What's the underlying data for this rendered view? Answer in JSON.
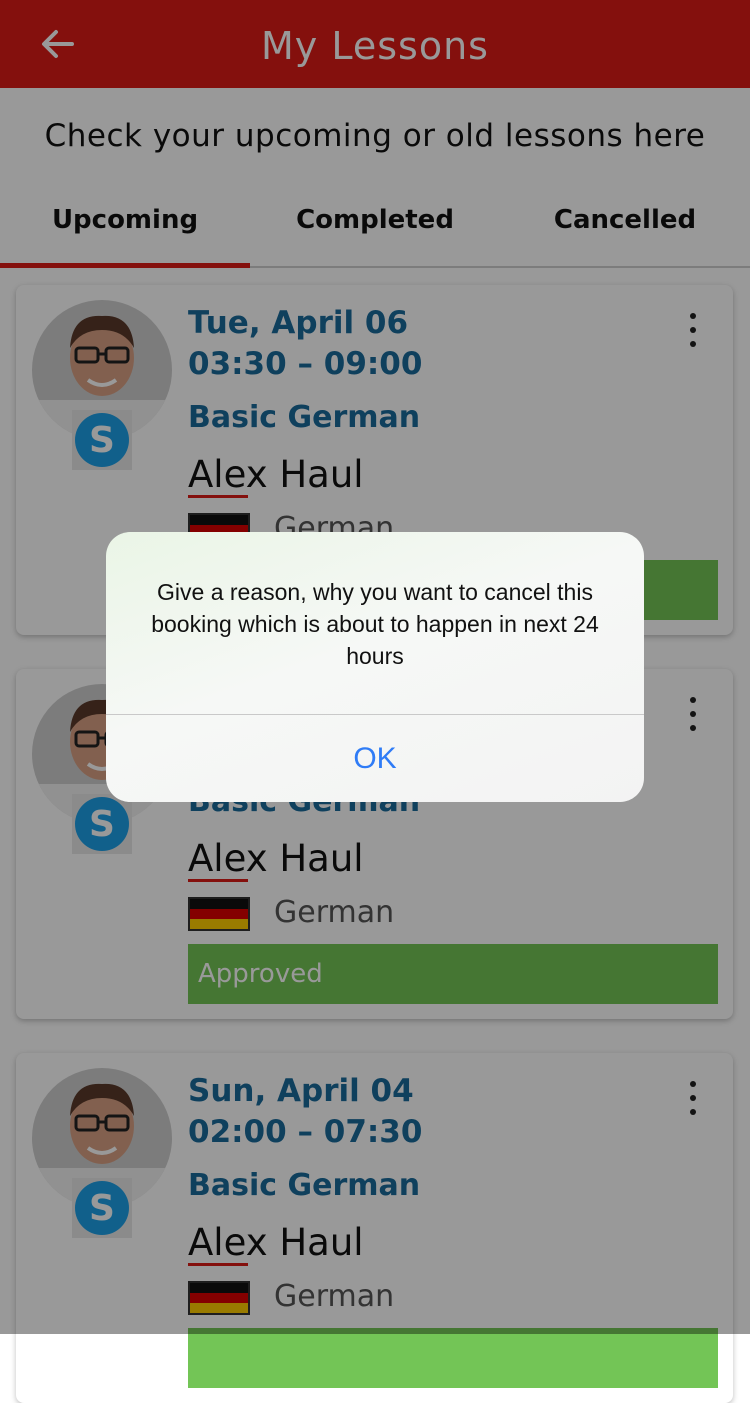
{
  "header": {
    "title": "My Lessons",
    "back_icon": "arrow-left-icon"
  },
  "subtitle": "Check your upcoming or old lessons here",
  "tabs": [
    {
      "label": "Upcoming",
      "active": true
    },
    {
      "label": "Completed",
      "active": false
    },
    {
      "label": "Cancelled",
      "active": false
    }
  ],
  "colors": {
    "brand": "#dd1c17",
    "accent_text": "#1a6b9c",
    "status_approved": "#73c556",
    "dialog_button": "#2f7cf6"
  },
  "lessons": [
    {
      "date": "Tue, April 06",
      "time": "03:30 – 09:00",
      "course": "Basic German",
      "teacher": "Alex Haul",
      "language": "German",
      "status": ""
    },
    {
      "date": "",
      "time": "",
      "course": "Basic German",
      "teacher": "Alex Haul",
      "language": "German",
      "status": "Approved"
    },
    {
      "date": "Sun, April 04",
      "time": "02:00 – 07:30",
      "course": "Basic German",
      "teacher": "Alex Haul",
      "language": "German",
      "status": ""
    }
  ],
  "dialog": {
    "message": "Give a reason, why you want to cancel this booking which is about to happen in next 24 hours",
    "ok_label": "OK"
  }
}
